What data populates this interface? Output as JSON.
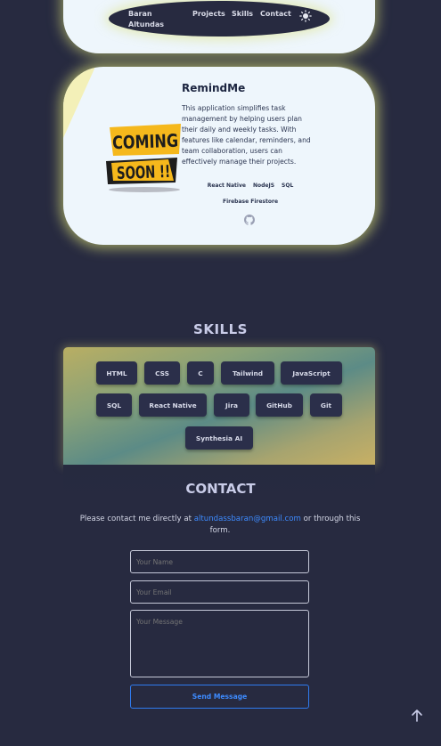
{
  "nav": {
    "brand_line1": "Baran",
    "brand_line2": "Altundas",
    "projects": "Projects",
    "skills": "Skills",
    "contact": "Contact",
    "theme_icon": "sun-icon"
  },
  "project": {
    "title": "RemindMe",
    "description": "This application simplifies task management by helping users plan their daily and weekly tasks. With features like calendar, reminders, and team collaboration, users can effectively manage their projects.",
    "badge_line1": "COMING",
    "badge_line2": "SOON !!",
    "tags": [
      "React Native",
      "NodeJS",
      "SQL",
      "Firebase Firestore"
    ],
    "repo_icon": "github-icon"
  },
  "skills": {
    "title": "SKILLS",
    "items": [
      "HTML",
      "CSS",
      "C",
      "Tailwind",
      "JavaScript",
      "SQL",
      "React Native",
      "Jira",
      "GitHub",
      "Git",
      "Synthesia AI"
    ]
  },
  "contact": {
    "title": "CONTACT",
    "text_before": "Please contact me directly at ",
    "email": "altundassbaran@gmail.com",
    "text_after": " or through this form.",
    "name_placeholder": "Your Name",
    "email_placeholder": "Your Email",
    "message_placeholder": "Your Message",
    "send_label": "Send Message"
  },
  "colors": {
    "background": "#272a40",
    "card": "#eef6fc",
    "accent": "#3d8bff",
    "badge_yellow": "#f5b81c"
  }
}
